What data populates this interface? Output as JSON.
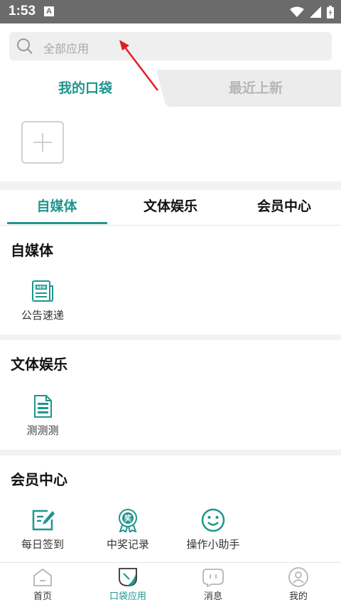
{
  "status_bar": {
    "time": "1:53",
    "notification_letter": "A"
  },
  "search": {
    "placeholder": "全部应用"
  },
  "pocket_tabs": {
    "mine": "我的口袋",
    "recent": "最近上新"
  },
  "category_tabs": [
    "自媒体",
    "文体娱乐",
    "会员中心"
  ],
  "sections": [
    {
      "title": "自媒体",
      "apps": [
        {
          "label": "公告速递",
          "icon": "news-icon"
        }
      ]
    },
    {
      "title": "文体娱乐",
      "apps": [
        {
          "label": "测测测",
          "icon": "document-icon"
        }
      ]
    },
    {
      "title": "会员中心",
      "apps": [
        {
          "label": "每日签到",
          "icon": "checkin-icon"
        },
        {
          "label": "中奖记录",
          "icon": "award-icon"
        },
        {
          "label": "操作小助手",
          "icon": "smile-icon"
        }
      ]
    }
  ],
  "bottom_nav": [
    {
      "label": "首页",
      "icon": "home-icon"
    },
    {
      "label": "口袋应用",
      "icon": "pocket-icon"
    },
    {
      "label": "消息",
      "icon": "message-icon"
    },
    {
      "label": "我的",
      "icon": "profile-icon"
    }
  ],
  "colors": {
    "accent": "#1e968e",
    "status_bar": "#6b6b6b",
    "inactive": "#b6b6b6"
  }
}
